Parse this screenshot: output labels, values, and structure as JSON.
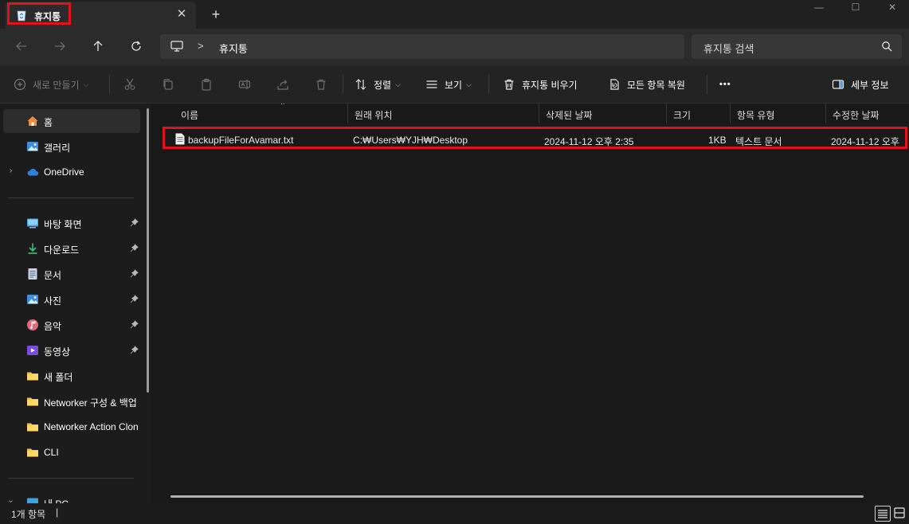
{
  "tab": {
    "title": "휴지통",
    "close": "✕",
    "new": "+"
  },
  "window": {
    "minimize": "—",
    "maximize": "☐",
    "close": "✕"
  },
  "address": {
    "separator": ">",
    "path": "휴지통"
  },
  "search": {
    "placeholder": "휴지통 검색"
  },
  "toolbar": {
    "new_label": "새로 만들기",
    "sort_label": "정렬",
    "view_label": "보기",
    "empty_label": "휴지통 비우기",
    "restore_all_label": "모든 항목 복원",
    "more_label": "•••",
    "details_label": "세부 정보",
    "chevron": "⌵"
  },
  "sidebar": {
    "home": "홈",
    "gallery": "갤러리",
    "onedrive": "OneDrive",
    "expand": "›",
    "pinned": [
      {
        "label": "바탕 화면"
      },
      {
        "label": "다운로드"
      },
      {
        "label": "문서"
      },
      {
        "label": "사진"
      },
      {
        "label": "음악"
      },
      {
        "label": "동영상"
      }
    ],
    "folders": [
      {
        "label": "새 폴더"
      },
      {
        "label": "Networker 구성 & 백업"
      },
      {
        "label": "Networker Action Clon"
      },
      {
        "label": "CLI"
      }
    ],
    "this_pc": "내 PC"
  },
  "columns": [
    "이름",
    "원래 위치",
    "삭제된 날짜",
    "크기",
    "항목 유형",
    "수정한 날짜"
  ],
  "sort_indicator": "^",
  "files": [
    {
      "name": "backupFileForAvamar.txt",
      "original_location": "C:₩Users₩YJH₩Desktop",
      "deleted_date": "2024-11-12 오후 2:35",
      "size": "1KB",
      "type": "텍스트 문서",
      "modified_date": "2024-11-12 오후"
    }
  ],
  "status": {
    "count": "1개 항목",
    "caret": "|"
  },
  "colors": {
    "highlight": "#e0131a",
    "folder": "#f5c343",
    "accent": "#4ea0e6"
  }
}
